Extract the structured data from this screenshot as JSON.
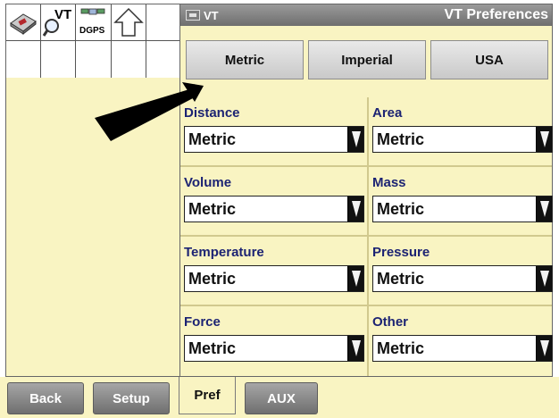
{
  "window": {
    "badge": "VT",
    "title": "VT Preferences"
  },
  "sidebar": {
    "icons": [
      "settings-cube-icon",
      "vt-search-icon",
      "dgps-icon",
      "up-arrow-icon"
    ],
    "dgps_label": "DGPS",
    "vt_label": "VT"
  },
  "unit_buttons": [
    "Metric",
    "Imperial",
    "USA"
  ],
  "preferences": [
    {
      "label": "Distance",
      "value": "Metric"
    },
    {
      "label": "Area",
      "value": "Metric"
    },
    {
      "label": "Volume",
      "value": "Metric"
    },
    {
      "label": "Mass",
      "value": "Metric"
    },
    {
      "label": "Temperature",
      "value": "Metric"
    },
    {
      "label": "Pressure",
      "value": "Metric"
    },
    {
      "label": "Force",
      "value": "Metric"
    },
    {
      "label": "Other",
      "value": "Metric"
    }
  ],
  "tabs": {
    "back": "Back",
    "setup": "Setup",
    "pref": "Pref",
    "aux": "AUX"
  },
  "colors": {
    "panel": "#f9f4c2",
    "label": "#1c2373",
    "titlebar": "#7d7d7d"
  }
}
